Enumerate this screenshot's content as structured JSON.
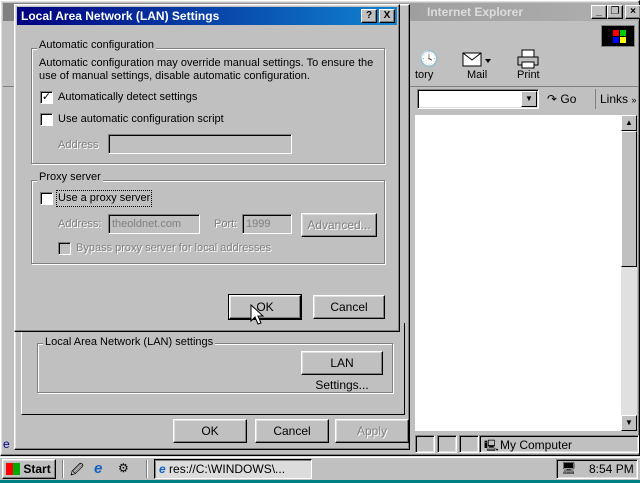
{
  "ie_window": {
    "title": "Internet Explorer",
    "toolbar": {
      "history_label": "tory",
      "mail_label": "Mail",
      "print_label": "Print"
    },
    "address_dropdown": "▼",
    "go_label": "Go",
    "links_label": "Links",
    "status": {
      "zone_label": "My Computer"
    }
  },
  "internet_options": {
    "lan_group_title": "Local Area Network (LAN) settings",
    "lan_settings_button": "LAN Settings...",
    "ok_label": "OK",
    "cancel_label": "Cancel",
    "apply_label": "Apply"
  },
  "lan_dialog": {
    "title": "Local Area Network (LAN) Settings",
    "help_btn": "?",
    "close_btn": "X",
    "auto_group": {
      "title": "Automatic configuration",
      "description": "Automatic configuration may override manual settings.  To ensure the use of manual settings, disable automatic configuration.",
      "auto_detect_label": "Automatically detect settings",
      "auto_detect_checked": true,
      "script_label": "Use automatic configuration script",
      "script_checked": false,
      "address_label": "Address",
      "address_value": ""
    },
    "proxy_group": {
      "title": "Proxy server",
      "use_proxy_label": "Use a proxy server",
      "use_proxy_checked": false,
      "address_label": "Address:",
      "address_value": "theoldnet.com",
      "port_label": "Port:",
      "port_value": "1999",
      "advanced_label": "Advanced...",
      "bypass_label": "Bypass proxy server for local addresses"
    },
    "ok_label": "OK",
    "cancel_label": "Cancel"
  },
  "taskbar": {
    "start_label": "Start",
    "task_label": "res://C:\\WINDOWS\\...",
    "clock": "8:54 PM"
  },
  "colors": {
    "desktop": "#008080",
    "title_active": "#000080",
    "title_inactive": "#808080",
    "face": "#c0c0c0"
  }
}
